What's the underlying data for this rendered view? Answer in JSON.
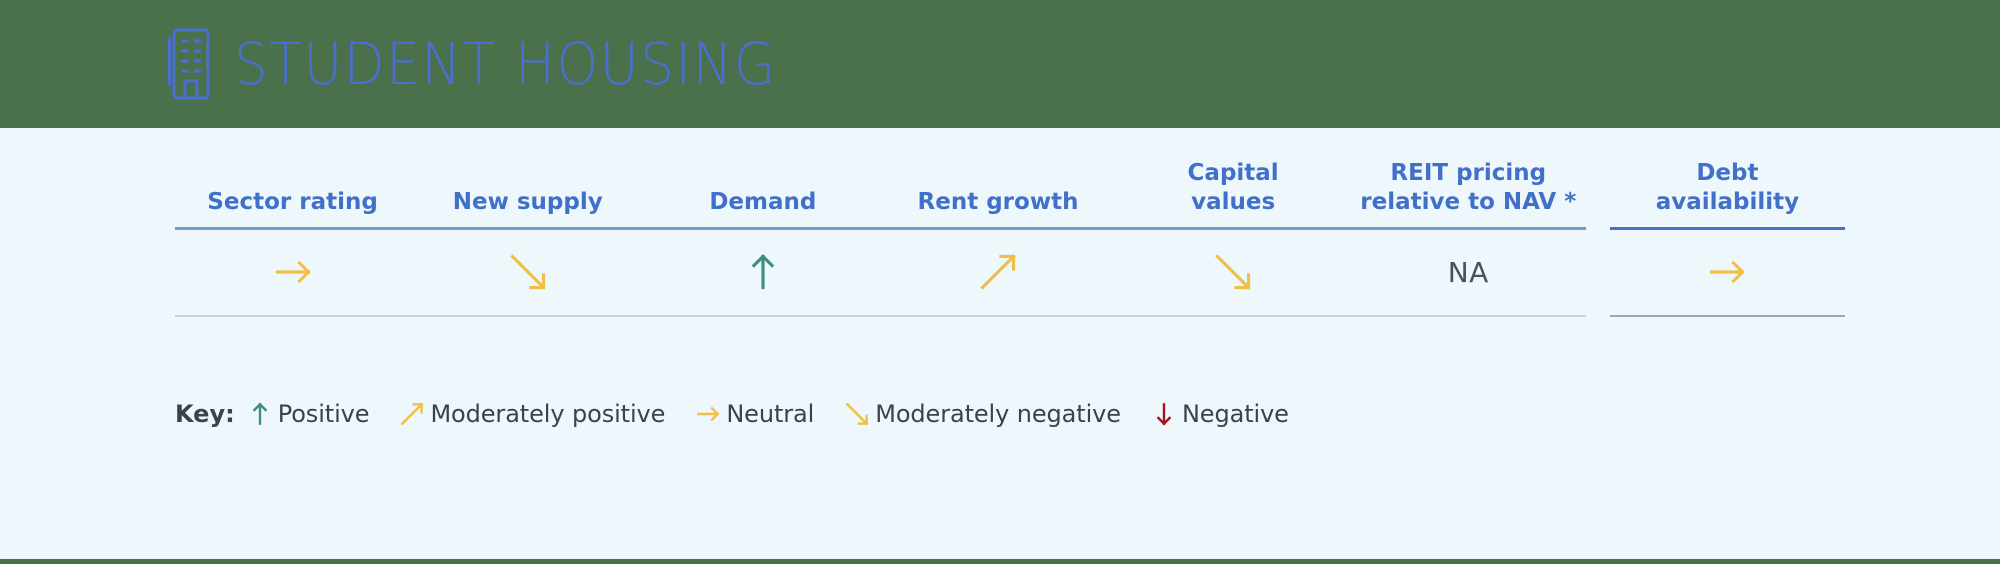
{
  "header": {
    "title": "STUDENT HOUSING",
    "icon": "building-icon",
    "band_color": "#4a714c",
    "title_color": "#4a6fd0"
  },
  "page": {
    "background_color": "#eef8fc"
  },
  "table": {
    "columns": [
      {
        "label": "Sector rating",
        "value_type": "arrow",
        "direction": "right",
        "color": "#efc044",
        "highlight": false
      },
      {
        "label": "New supply",
        "value_type": "arrow",
        "direction": "down-right",
        "color": "#efc044",
        "highlight": false
      },
      {
        "label": "Demand",
        "value_type": "arrow",
        "direction": "up",
        "color": "#3d8d82",
        "highlight": false
      },
      {
        "label": "Rent growth",
        "value_type": "arrow",
        "direction": "up-right",
        "color": "#efc044",
        "highlight": false
      },
      {
        "label": "Capital\nvalues",
        "value_type": "arrow",
        "direction": "down-right",
        "color": "#efc044",
        "highlight": false
      },
      {
        "label": "REIT pricing\nrelative to NAV *",
        "value_type": "text",
        "text": "NA",
        "color": "#4a5257",
        "highlight": false
      },
      {
        "label": "Debt\navailability",
        "value_type": "arrow",
        "direction": "right",
        "color": "#efc044",
        "highlight": true
      }
    ]
  },
  "key": {
    "label": "Key:",
    "items": [
      {
        "text": "Positive",
        "direction": "up",
        "color": "#3d8d82"
      },
      {
        "text": "Moderately positive",
        "direction": "up-right",
        "color": "#efc044"
      },
      {
        "text": "Neutral",
        "direction": "right",
        "color": "#efc044"
      },
      {
        "text": "Moderately negative",
        "direction": "down-right",
        "color": "#efc044"
      },
      {
        "text": "Negative",
        "direction": "down",
        "color": "#a5141a"
      }
    ]
  }
}
